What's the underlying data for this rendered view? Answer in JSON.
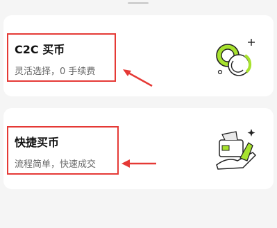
{
  "options": [
    {
      "title": "C2C 买币",
      "subtitle": "灵活选择，0 手续费",
      "illustration_icon": "coins-icon"
    },
    {
      "title": "快捷买币",
      "subtitle": "流程简单，快速成交",
      "illustration_icon": "hand-card-icon"
    }
  ],
  "colors": {
    "background": "#f5f5f5",
    "card": "#ffffff",
    "accent": "#a7e22e",
    "annotation": "#e53935"
  }
}
